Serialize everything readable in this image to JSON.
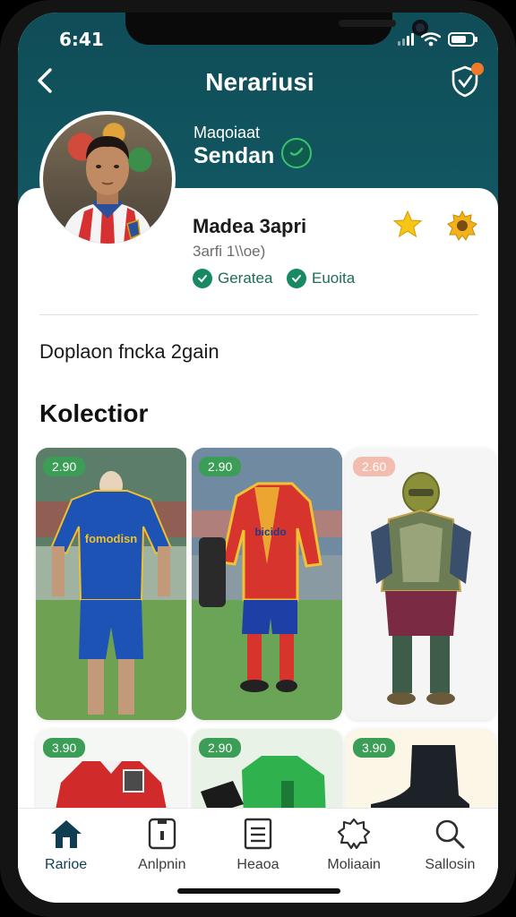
{
  "status": {
    "time": "6:41"
  },
  "header": {
    "title": "Nerariusi"
  },
  "intro": {
    "small": "Maqoiaat",
    "name": "Sendan"
  },
  "profile": {
    "name": "Madea 3apri",
    "subtitle": "3arfi 1\\\\oe)",
    "chips": [
      "Geratea",
      "Euoita"
    ]
  },
  "description": "Doplaon fncka 2gain",
  "collection": {
    "title": "Kolectior",
    "items": [
      {
        "badge": "2.90",
        "jersey_text": "fomodisn"
      },
      {
        "badge": "2.90",
        "jersey_text": "bicido"
      },
      {
        "badge": "2.60"
      },
      {
        "badge": "3.90"
      },
      {
        "badge": "2.90"
      },
      {
        "badge": "3.90"
      }
    ]
  },
  "tabs": [
    {
      "label": "Rarioe",
      "icon": "home-icon"
    },
    {
      "label": "Anlpnin",
      "icon": "device-icon"
    },
    {
      "label": "Heaoa",
      "icon": "document-icon"
    },
    {
      "label": "Moliaain",
      "icon": "badge-icon"
    },
    {
      "label": "Sallosin",
      "icon": "search-icon"
    }
  ],
  "colors": {
    "header": "#0f4d57",
    "accent_green": "#3c9d56",
    "verify": "#188a63",
    "notification": "#f07a2a",
    "star": "#f5c518"
  }
}
